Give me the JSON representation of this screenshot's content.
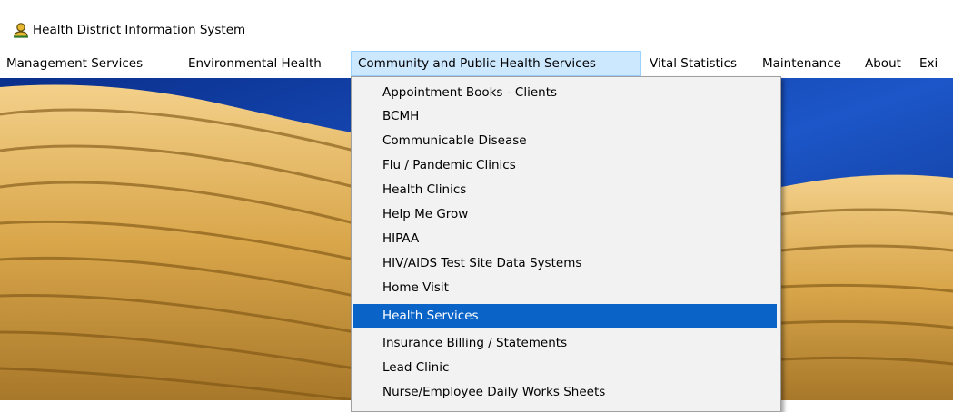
{
  "window": {
    "title": "Health District Information System",
    "icon": "person-gold-icon"
  },
  "menubar": {
    "items": [
      {
        "label": "Management Services"
      },
      {
        "label": "Environmental Health"
      },
      {
        "label": "Community and Public Health Services",
        "open": true
      },
      {
        "label": "Vital Statistics"
      },
      {
        "label": "Maintenance"
      },
      {
        "label": "About"
      },
      {
        "label": "Exi"
      }
    ]
  },
  "dropdown": {
    "items": [
      {
        "label": "Appointment Books - Clients"
      },
      {
        "label": "BCMH"
      },
      {
        "label": "Communicable Disease"
      },
      {
        "label": "Flu / Pandemic Clinics"
      },
      {
        "label": "Health Clinics"
      },
      {
        "label": "Help Me Grow"
      },
      {
        "label": "HIPAA"
      },
      {
        "label": "HIV/AIDS Test Site Data Systems"
      },
      {
        "label": "Home Visit"
      },
      {
        "label": "Health Services",
        "selected": true
      },
      {
        "label": "Insurance Billing / Statements"
      },
      {
        "label": "Lead Clinic"
      },
      {
        "label": "Nurse/Employee Daily Works Sheets"
      }
    ]
  },
  "colors": {
    "selection": "#0a64c8",
    "menu_open_bg": "#cce8ff",
    "wallpaper_blue": "#0d3a9e",
    "wallpaper_gold": "#e3b557"
  }
}
